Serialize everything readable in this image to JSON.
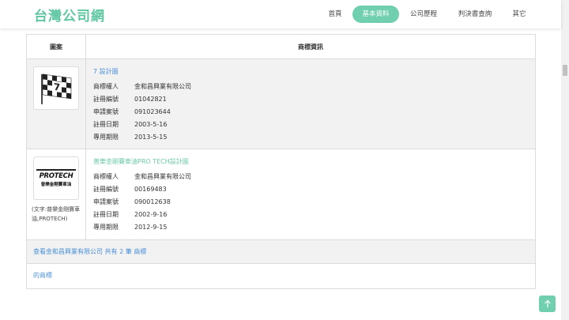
{
  "header": {
    "logo": "台灣公司網",
    "nav": [
      {
        "label": "首頁",
        "active": false
      },
      {
        "label": "基本資料",
        "active": true
      },
      {
        "label": "公司歷程",
        "active": false
      },
      {
        "label": "判決書查詢",
        "active": false
      },
      {
        "label": "其它",
        "active": false
      }
    ]
  },
  "table": {
    "headers": {
      "image": "圖案",
      "info": "商標資訊"
    },
    "field_labels": {
      "owner": "商標權人",
      "reg_no": "註冊編號",
      "app_no": "申請案號",
      "reg_date": "註冊日期",
      "expiry": "專用期限"
    },
    "rows": [
      {
        "title": "7 設計圖",
        "owner": "金和昌興業有限公司",
        "reg_no": "01042821",
        "app_no": "091023644",
        "reg_date": "2003-5-16",
        "expiry": "2013-5-15",
        "caption": ""
      },
      {
        "title": "普樂金剛賽車油PRO TECH設計圖",
        "owner": "金和昌興業有限公司",
        "reg_no": "00169483",
        "app_no": "090012638",
        "reg_date": "2002-9-16",
        "expiry": "2012-9-15",
        "caption": "(文字:普樂金剛賽車油,PROTECH)",
        "logo_text": "PROTECH",
        "logo_subtext": "普樂金剛賽車油"
      }
    ],
    "footer_link": "查看金和昌興業有限公司 共有 2 筆 商標",
    "footer_link2": "的商標"
  },
  "colors": {
    "brand": "#5ec7a1",
    "link": "#4a8fd6",
    "row_alt": "#f2f2f2"
  },
  "back_to_top_icon": "arrow-up-icon"
}
